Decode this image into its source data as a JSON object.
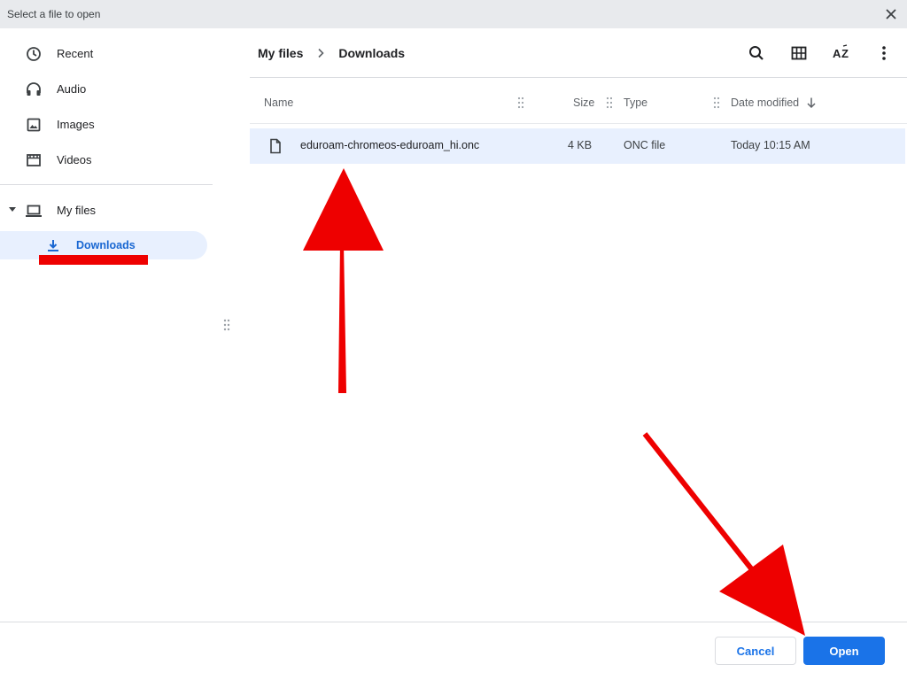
{
  "titlebar": {
    "title": "Select a file to open",
    "close_icon": "close-icon"
  },
  "sidebar": {
    "items": [
      {
        "label": "Recent",
        "icon": "clock-icon"
      },
      {
        "label": "Audio",
        "icon": "headphones-icon"
      },
      {
        "label": "Images",
        "icon": "image-icon"
      },
      {
        "label": "Videos",
        "icon": "film-icon"
      },
      {
        "label": "My files",
        "icon": "laptop-icon",
        "expanded": true
      },
      {
        "label": "Downloads",
        "icon": "download-icon",
        "selected": true
      }
    ]
  },
  "breadcrumb": {
    "items": [
      "My files",
      "Downloads"
    ]
  },
  "toolbar": {
    "search_icon": "search-icon",
    "grid_view_icon": "grid-view-icon",
    "sort_icon": "sort-az-icon",
    "more_icon": "more-vert-icon"
  },
  "file_list": {
    "columns": {
      "name": "Name",
      "size": "Size",
      "type": "Type",
      "date": "Date modified"
    },
    "sort": {
      "column": "Date modified",
      "direction": "descending"
    },
    "rows": [
      {
        "name": "eduroam-chromeos-eduroam_hi.onc",
        "size": "4 KB",
        "type": "ONC file",
        "date": "Today 10:15 AM",
        "selected": true
      }
    ]
  },
  "footer": {
    "cancel_label": "Cancel",
    "open_label": "Open"
  },
  "colors": {
    "accent": "#1a73e8",
    "selected_bg": "#e8f0fe",
    "titlebar_bg": "#e8eaed",
    "annotation": "#ee0000"
  }
}
